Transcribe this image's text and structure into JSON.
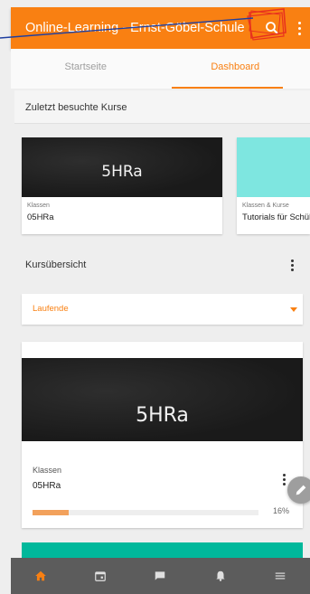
{
  "appbar": {
    "title": "Online-Learning - Ernst-Göbel-Schule"
  },
  "tabs": [
    {
      "label": "Startseite",
      "active": false
    },
    {
      "label": "Dashboard",
      "active": true
    }
  ],
  "recent": {
    "title": "Zuletzt besuchte Kurse",
    "courses": [
      {
        "image_text": "5HRa",
        "category": "Klassen",
        "name": "05HRa"
      },
      {
        "image_text": "",
        "category": "Klassen & Kurse",
        "name": "Tutorials für Schüler"
      }
    ]
  },
  "overview": {
    "title": "Kursübersicht",
    "filter": {
      "selected": "Laufende"
    },
    "course": {
      "image_text": "5HRa",
      "category": "Klassen",
      "name": "05HRa",
      "progress": 16,
      "progress_label": "16%"
    }
  },
  "bottom_nav": [
    {
      "icon": "home-icon",
      "active": true
    },
    {
      "icon": "calendar-icon",
      "active": false
    },
    {
      "icon": "messages-icon",
      "active": false
    },
    {
      "icon": "bell-icon",
      "active": false
    },
    {
      "icon": "menu-icon",
      "active": false
    }
  ],
  "colors": {
    "accent": "#f98012",
    "nav_bg": "#5c5c5c",
    "teal": "#00b89b"
  }
}
